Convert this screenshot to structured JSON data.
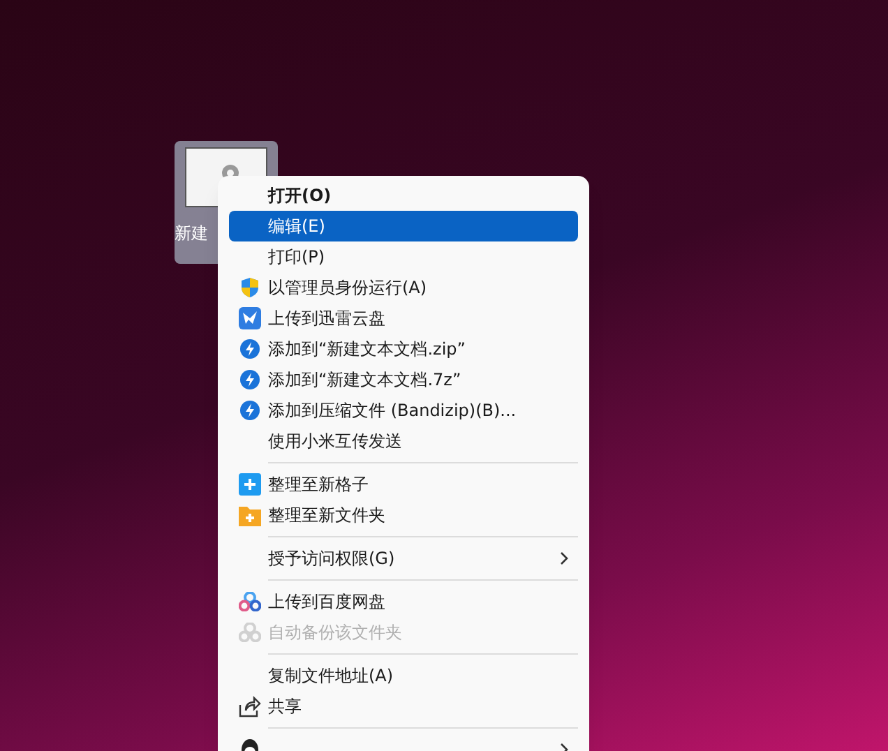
{
  "desktop_icon": {
    "label": "新建"
  },
  "menu": {
    "items": [
      {
        "kind": "item",
        "label": "打开(O)",
        "default": true,
        "selected": false,
        "disabled": false,
        "submenu": false
      },
      {
        "kind": "item",
        "label": "编辑(E)",
        "default": false,
        "selected": true,
        "disabled": false,
        "submenu": false
      },
      {
        "kind": "item",
        "label": "打印(P)",
        "default": false,
        "selected": false,
        "disabled": false,
        "submenu": false
      },
      {
        "kind": "item",
        "label": "以管理员身份运行(A)",
        "default": false,
        "selected": false,
        "disabled": false,
        "submenu": false
      },
      {
        "kind": "item",
        "label": "上传到迅雷云盘",
        "default": false,
        "selected": false,
        "disabled": false,
        "submenu": false
      },
      {
        "kind": "item",
        "label": "添加到“新建文本文档.zip”",
        "default": false,
        "selected": false,
        "disabled": false,
        "submenu": false
      },
      {
        "kind": "item",
        "label": "添加到“新建文本文档.7z”",
        "default": false,
        "selected": false,
        "disabled": false,
        "submenu": false
      },
      {
        "kind": "item",
        "label": "添加到压缩文件 (Bandizip)(B)...",
        "default": false,
        "selected": false,
        "disabled": false,
        "submenu": false
      },
      {
        "kind": "item",
        "label": "使用小米互传发送",
        "default": false,
        "selected": false,
        "disabled": false,
        "submenu": false
      },
      {
        "kind": "separator"
      },
      {
        "kind": "item",
        "label": "整理至新格子",
        "default": false,
        "selected": false,
        "disabled": false,
        "submenu": false
      },
      {
        "kind": "item",
        "label": "整理至新文件夹",
        "default": false,
        "selected": false,
        "disabled": false,
        "submenu": false
      },
      {
        "kind": "separator"
      },
      {
        "kind": "item",
        "label": "授予访问权限(G)",
        "default": false,
        "selected": false,
        "disabled": false,
        "submenu": true
      },
      {
        "kind": "separator"
      },
      {
        "kind": "item",
        "label": "上传到百度网盘",
        "default": false,
        "selected": false,
        "disabled": false,
        "submenu": false
      },
      {
        "kind": "item",
        "label": "自动备份该文件夹",
        "default": false,
        "selected": false,
        "disabled": true,
        "submenu": false
      },
      {
        "kind": "separator"
      },
      {
        "kind": "item",
        "label": "复制文件地址(A)",
        "default": false,
        "selected": false,
        "disabled": false,
        "submenu": false
      },
      {
        "kind": "item",
        "label": "共享",
        "default": false,
        "selected": false,
        "disabled": false,
        "submenu": false
      },
      {
        "kind": "separator"
      },
      {
        "kind": "item",
        "default": false,
        "selected": false,
        "disabled": false,
        "submenu": true
      }
    ]
  }
}
